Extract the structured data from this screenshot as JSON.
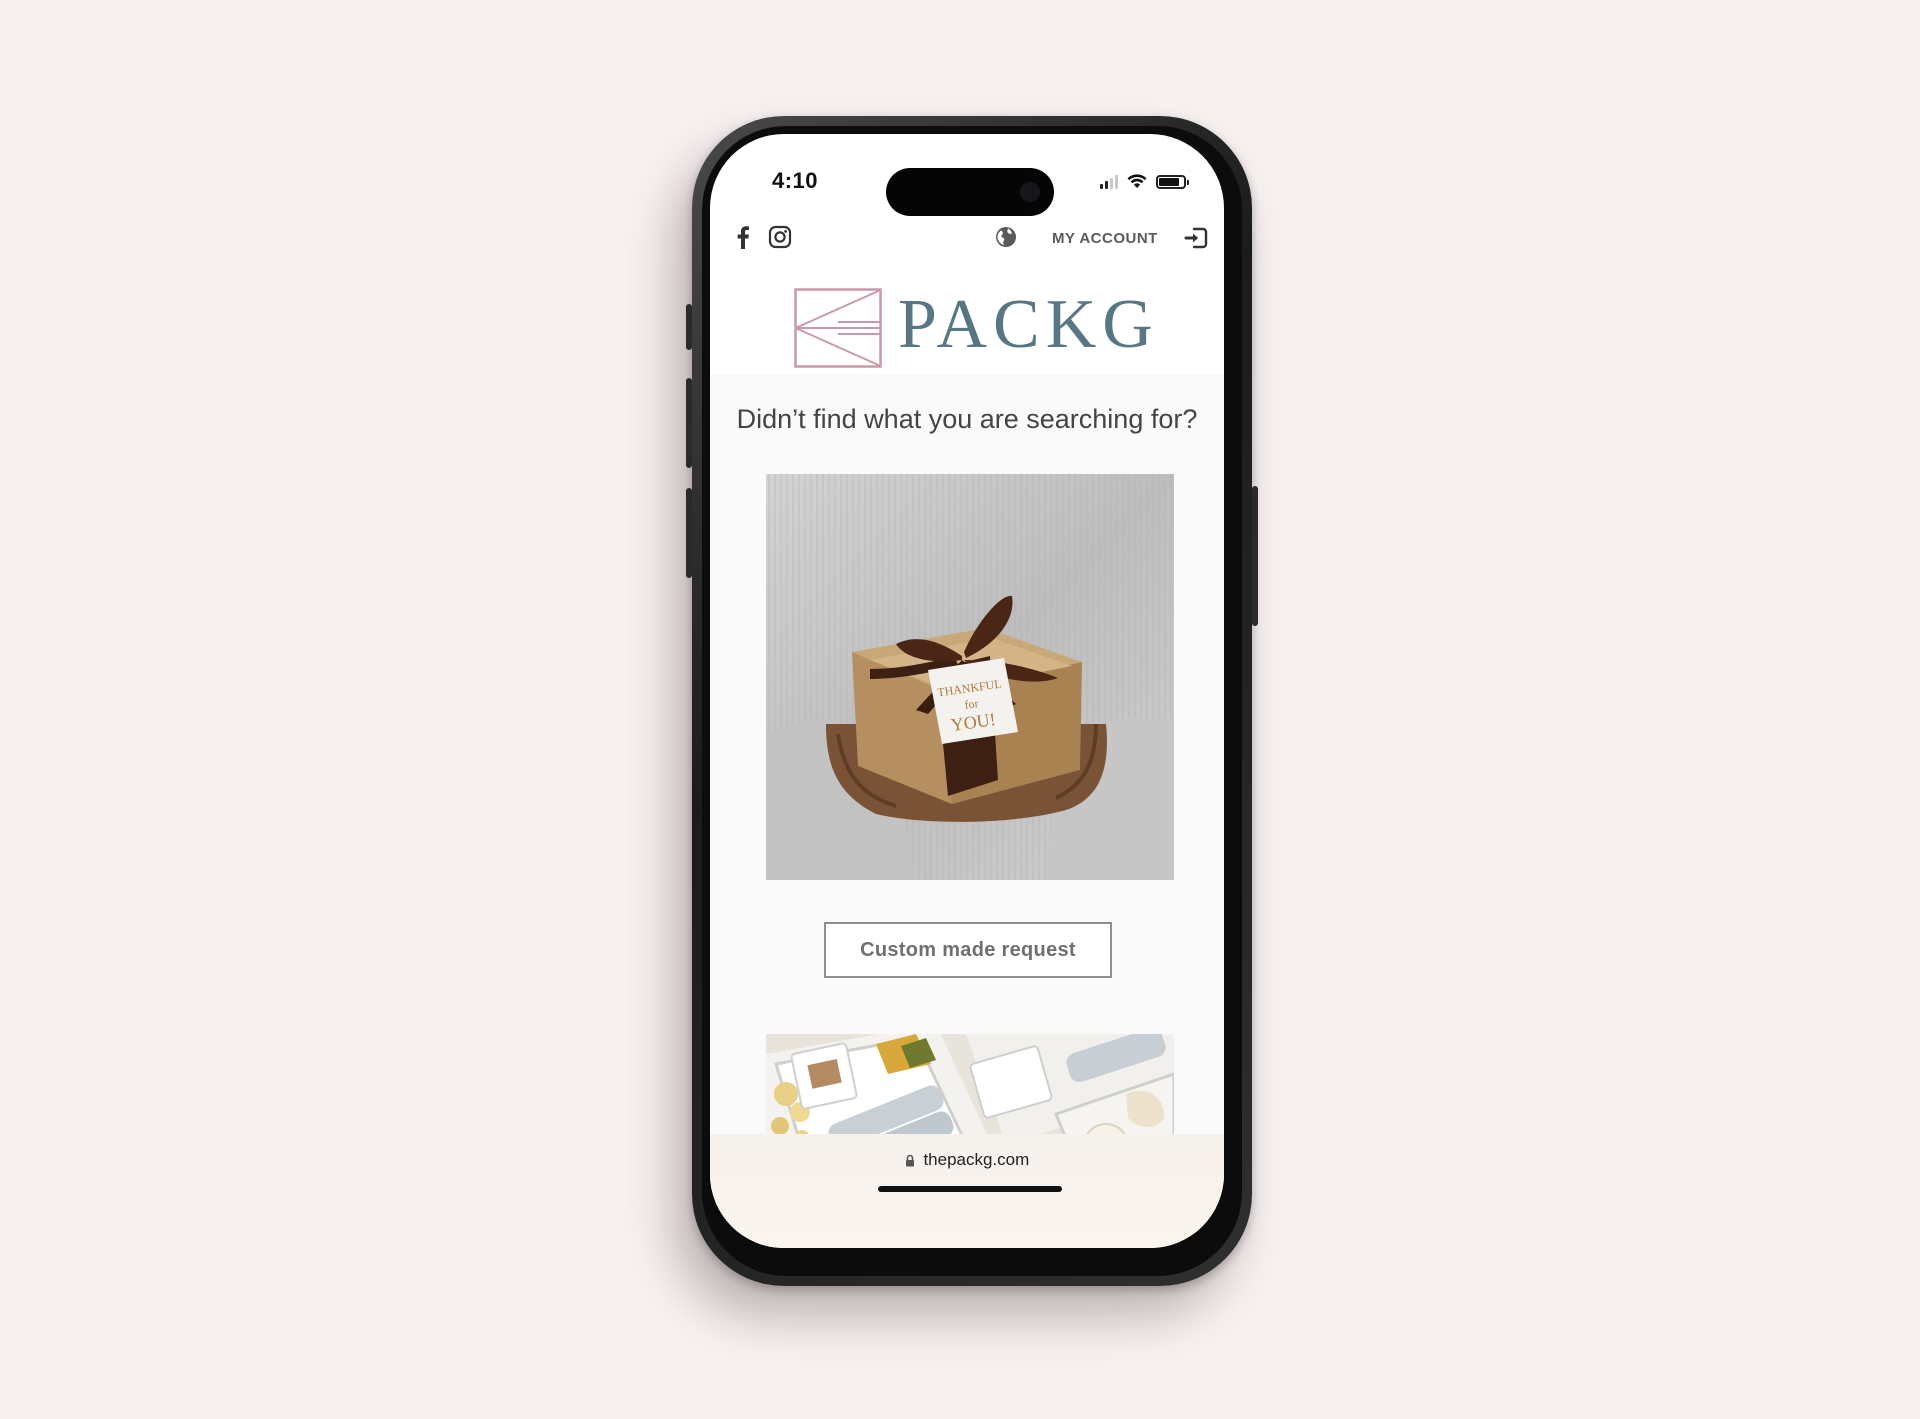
{
  "status_bar": {
    "time": "4:10"
  },
  "nav": {
    "account_label": "MY ACCOUNT",
    "icons": [
      "facebook-icon",
      "instagram-icon",
      "globe-icon",
      "login-icon"
    ]
  },
  "brand": {
    "name": "PACKG",
    "color": "#587785",
    "mark_color": "#c99aa6"
  },
  "main": {
    "heading": "Didn’t find what you are searching for?",
    "cta_label": "Custom made request"
  },
  "browser": {
    "url": "thepackg.com"
  },
  "hero_tag": {
    "line1": "THANKFUL",
    "line2": "for",
    "line3": "YOU!"
  }
}
